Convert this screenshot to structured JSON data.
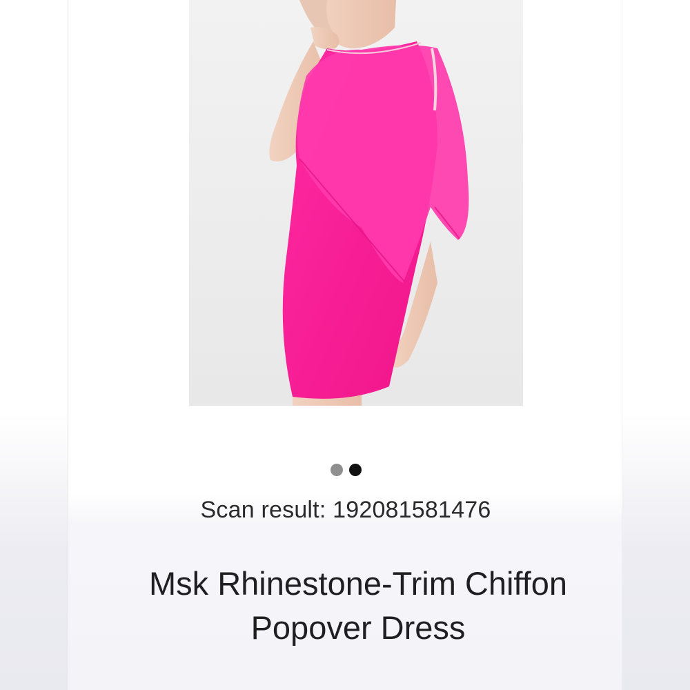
{
  "colors": {
    "dress": "#ff1f9a",
    "dot_active": "#111111",
    "dot_inactive": "#8f8f8f"
  },
  "gallery": {
    "image_alt_icon": "product-photo-pink-dress",
    "pagination": {
      "total": 2,
      "active_index": 1
    }
  },
  "scan": {
    "label": "Scan result: 192081581476"
  },
  "product": {
    "title": "Msk Rhinestone-Trim Chiffon Popover Dress"
  }
}
